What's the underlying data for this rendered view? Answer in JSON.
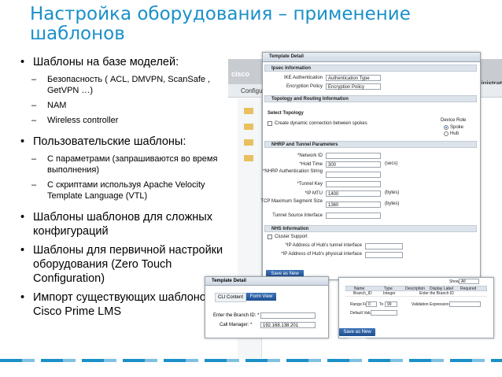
{
  "title": "Настройка оборудования – применение шаблонов",
  "bullets": {
    "b1": "Шаблоны на базе моделей:",
    "b1_sub": [
      "Безопасность ( ACL, DMVPN, ScanSafe , GetVPN …)",
      "NAM",
      "Wireless controller"
    ],
    "b2": "Пользовательские шаблоны:",
    "b2_sub": [
      "С параметрами (запрашиваются во время выполнения)",
      "С скриптами  используя Apache Velocity Template Language (VTL)"
    ],
    "b3": "Шаблоны шаблонов для сложных конфигураций",
    "b4": "Шаблоны для первичной настройки оборудования (Zero Touch Configuration)",
    "b5": "Импорт существующих шаблонов с Cisco Prime LMS"
  },
  "bgapp": {
    "logo": "cisco",
    "admin": "ministrat",
    "conf": "Configu"
  },
  "template_window": {
    "header": "Template Detail",
    "ipsec": {
      "section": "Ipsec Information",
      "ike_label": "IKE Authentication",
      "ike_value": "Authentication Type",
      "enc_label": "Encryption Policy",
      "enc_value": "Encryption Policy"
    },
    "topology": {
      "section": "Topology and Routing Information",
      "select": "Select Topology",
      "dynamic": "Create dynamic connection between spokes",
      "device_role": "Device Role",
      "spoke": "Spoke",
      "hub": "Hub"
    },
    "nhrp": {
      "section": "NHRP and Tunnel Parameters",
      "network_id": "*Network ID",
      "hold_time": "*Hold Time",
      "hold_value": "300",
      "hold_unit": "(secs)",
      "auth_string": "*NHRP Authentication String",
      "tunnel_key": "*Tunnel Key",
      "ip_mtu": "*IP MTU",
      "ip_mtu_value": "1400",
      "ip_mtu_unit": "(bytes)",
      "tcp_mss": "TCP Maximum Segment Size",
      "tcp_value": "1360",
      "tcp_unit": "(bytes)",
      "src_iface": "Tunnel Source Interface"
    },
    "nhs": {
      "section": "NHS Information",
      "cluster": "Cluster Support",
      "tunnel_if": "*IP Address of Hub's tunnel interface",
      "phys_if": "*IP Address of Hub's physical interface"
    },
    "save_button": "Save as New Template"
  },
  "cli_window": {
    "header": "Template Detail",
    "tab_cli": "CLI Content",
    "tab_form": "Form View",
    "branch_label": "Enter the Branch ID: *",
    "cm_label": "Call Manager: *",
    "cm_value": "192.168.138.201"
  },
  "grid_window": {
    "show": "Show",
    "all": "All",
    "cols": [
      "Name",
      "Type",
      "Description",
      "Display Label",
      "Required"
    ],
    "row1": [
      "Branch_ID",
      "Integer",
      "",
      "Enter the Branch ID",
      ""
    ],
    "range_from": "Range From",
    "range_from_val": "0",
    "to": "To",
    "to_val": "99",
    "validation": "Validation Expression",
    "default_value": "Default Value",
    "save_button": "Save as New Template"
  }
}
